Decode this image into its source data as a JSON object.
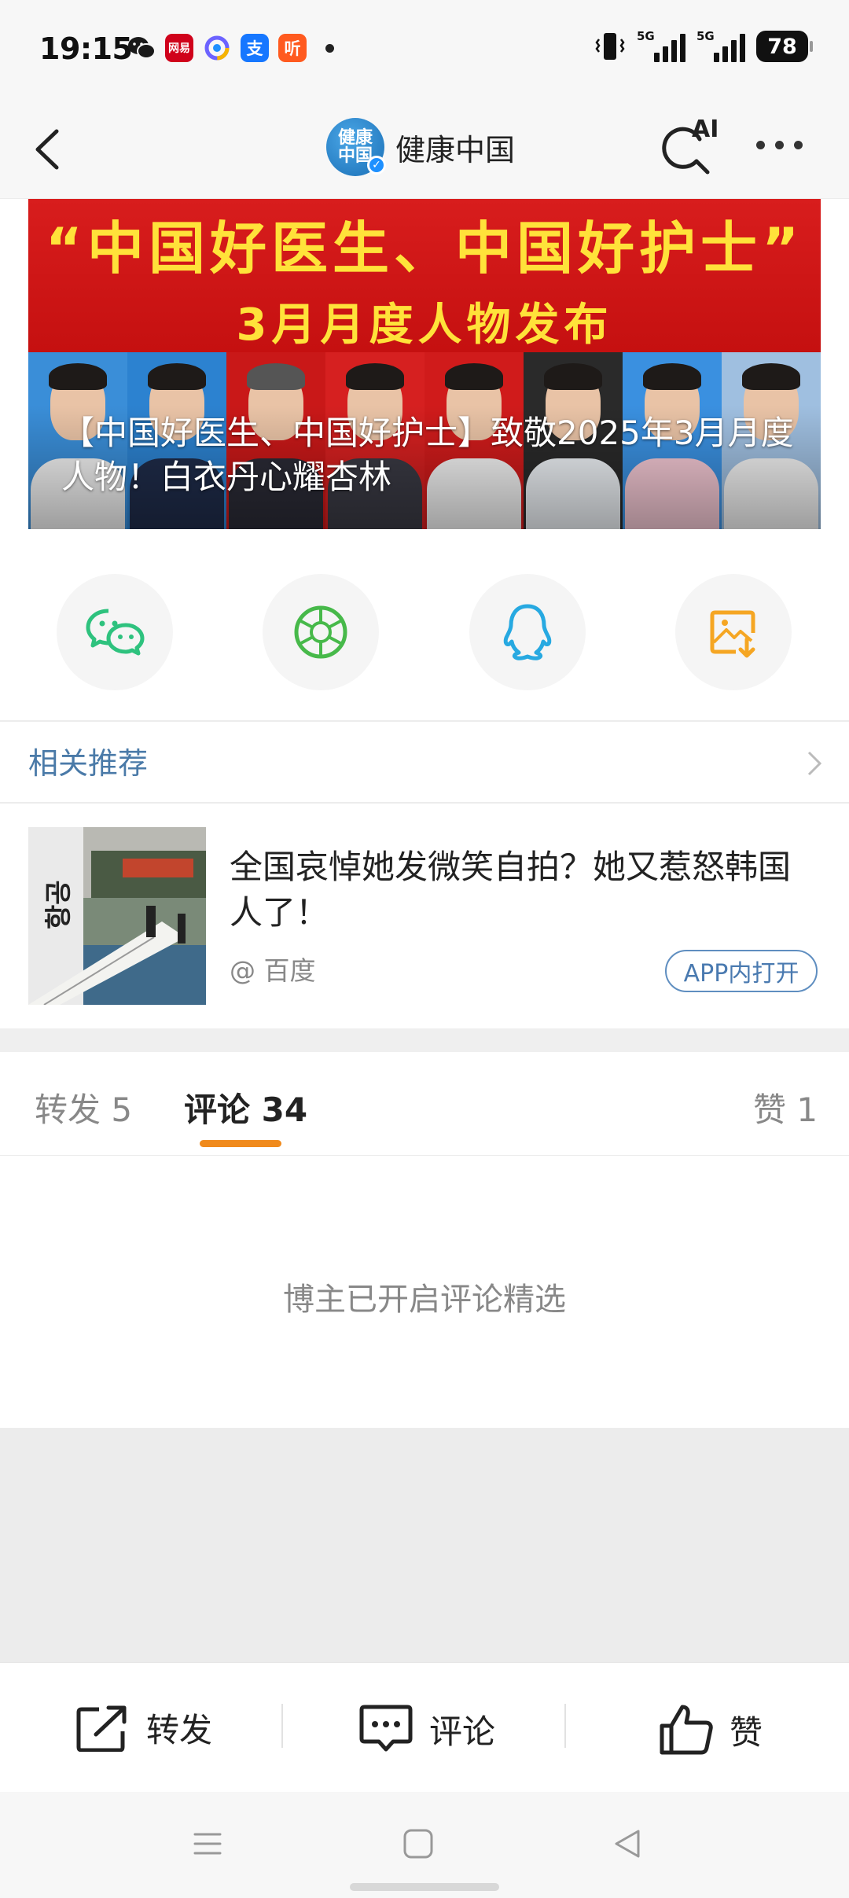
{
  "status_bar": {
    "time": "19:15",
    "apps": [
      {
        "icon": "wechat-icon",
        "label": "",
        "color": "#1a1a1a"
      },
      {
        "icon": "netease-news-icon",
        "label": "网易",
        "color": "#d0021b"
      },
      {
        "icon": "quark-icon",
        "label": "",
        "color": "#6c63ff"
      },
      {
        "icon": "alipay-icon",
        "label": "支",
        "color": "#1677ff"
      },
      {
        "icon": "listen-app-icon",
        "label": "听",
        "color": "#ff5a1f"
      }
    ],
    "signal_1_label": "5G",
    "signal_2_label": "5G",
    "battery": "78"
  },
  "nav": {
    "avatar_text": "健康中国",
    "title": "健康中国",
    "ai_label": "AI"
  },
  "banner": {
    "line1": "“中国好医生、中国好护士”",
    "line2": "3月月度人物发布",
    "caption": "【中国好医生、中国好护士】致敬2025年3月月度人物！白衣丹心耀杏林"
  },
  "share": {
    "items": [
      "wechat-share-icon",
      "moments-share-icon",
      "qq-share-icon",
      "save-image-icon"
    ]
  },
  "related": {
    "heading": "相关推荐",
    "item": {
      "title": "全国哀悼她发微笑自拍？她又惹怒韩国人了！",
      "source": "@ 百度",
      "open_button": "APP内打开"
    }
  },
  "tabs": {
    "repost": "转发 5",
    "comment": "评论 34",
    "like": "赞 1"
  },
  "comments": {
    "notice": "博主已开启评论精选"
  },
  "actions": {
    "repost": "转发",
    "comment": "评论",
    "like": "赞"
  },
  "colors": {
    "accent_orange": "#f08a1c",
    "link_blue": "#4a7aa8",
    "banner_red": "#d81d1d",
    "banner_yellow": "#ffe23a"
  }
}
